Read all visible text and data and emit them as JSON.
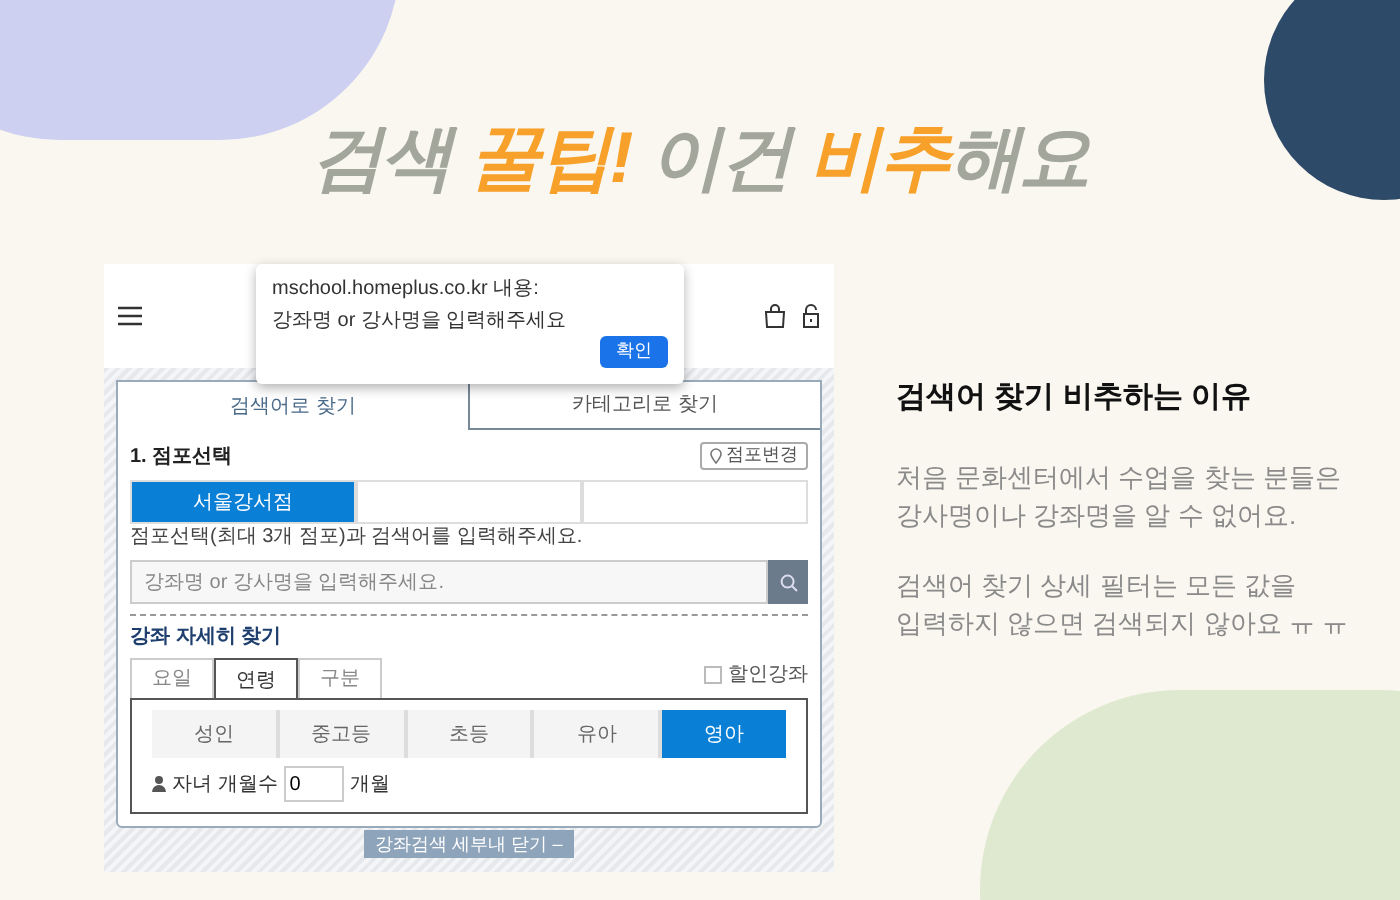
{
  "headline": [
    {
      "text": "검색 ",
      "highlight": false
    },
    {
      "text": "꿀팁! ",
      "highlight": true
    },
    {
      "text": "이건 ",
      "highlight": false
    },
    {
      "text": "비추",
      "highlight": true
    },
    {
      "text": "해요",
      "highlight": false
    }
  ],
  "screenshot": {
    "dialog": {
      "origin": "mschool.homeplus.co.kr 내용:",
      "message": "강좌명 or 강사명을 입력해주세요",
      "ok": "확인"
    },
    "search_tabs": [
      {
        "label": "검색어로 찾기",
        "selected": true
      },
      {
        "label": "카테고리로 찾기",
        "selected": false
      }
    ],
    "store_section": {
      "heading": "1. 점포선택",
      "change_button": "점포변경",
      "stores": [
        {
          "label": "서울강서점",
          "selected": true
        }
      ],
      "hint": "점포선택(최대 3개 점포)과 검색어를 입력해주세요."
    },
    "search": {
      "placeholder": "강좌명 or 강사명을 입력해주세요."
    },
    "detail": {
      "heading": "강좌 자세히 찾기",
      "discount": {
        "label": "할인강좌",
        "checked": false
      },
      "tabs": [
        {
          "label": "요일",
          "selected": false
        },
        {
          "label": "연령",
          "selected": true
        },
        {
          "label": "구분",
          "selected": false
        }
      ],
      "ages": [
        {
          "label": "성인",
          "selected": false
        },
        {
          "label": "중고등",
          "selected": false
        },
        {
          "label": "초등",
          "selected": false
        },
        {
          "label": "유아",
          "selected": false
        },
        {
          "label": "영아",
          "selected": true
        }
      ],
      "months": {
        "label": "자녀 개월수",
        "value": "0",
        "unit": "개월"
      }
    },
    "close_button": "강좌검색 세부내 닫기 –"
  },
  "reason": {
    "heading": "검색어 찾기 비추하는 이유",
    "paragraphs": [
      "처음 문화센터에서 수업을 찾는 분들은 강사명이나 강좌명을 알 수 없어요.",
      "검색어 찾기 상세 필터는 모든 값을 입력하지 않으면 검색되지 않아요 ㅠ ㅠ"
    ]
  }
}
